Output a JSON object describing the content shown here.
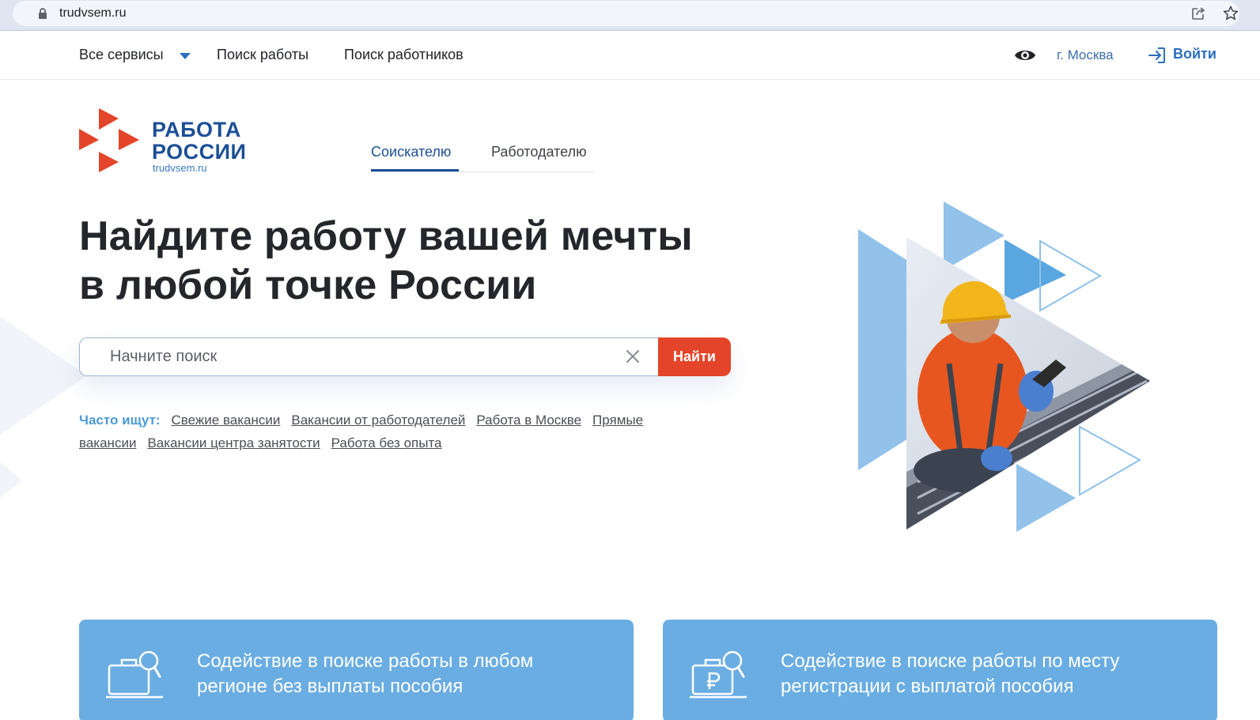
{
  "browser": {
    "url": "trudvsem.ru",
    "icons": [
      "lock-icon",
      "share-icon",
      "star-icon"
    ]
  },
  "topnav": {
    "services": "Все сервисы",
    "search_work": "Поиск работы",
    "search_workers": "Поиск работников",
    "city": "г. Москва",
    "login": "Войти",
    "icons": [
      "chevron-down-icon",
      "eye-icon",
      "login-icon"
    ]
  },
  "logo": {
    "line1": "РАБОТА",
    "line2": "РОССИИ",
    "sub": "trudvsem.ru"
  },
  "tabs": {
    "seeker": "Соискателю",
    "employer": "Работодателю",
    "active": "seeker"
  },
  "hero": {
    "headline_line1": "Найдите работу вашей мечты",
    "headline_line2": "в любой точке России",
    "search": {
      "placeholder": "Начните поиск",
      "value": "",
      "button": "Найти"
    },
    "popular": {
      "label": "Часто ищут:",
      "links": [
        "Свежие вакансии",
        "Вакансии от работодателей",
        "Работа в Москве",
        "Прямые вакансии",
        "Вакансии центра занятости",
        "Работа без опыта"
      ]
    }
  },
  "cards": [
    {
      "line1": "Содействие в поиске работы в любом",
      "line2": "регионе без выплаты пособия",
      "icon": "briefcase-search-icon"
    },
    {
      "line1": "Содействие в поиске работы по месту",
      "line2": "регистрации с выплатой пособия",
      "icon": "ruble-briefcase-search-icon"
    }
  ],
  "colors": {
    "brand_blue": "#1c4f96",
    "accent_red": "#e4452a",
    "card_blue": "#6aade2",
    "link_blue": "#2a6ebe"
  }
}
